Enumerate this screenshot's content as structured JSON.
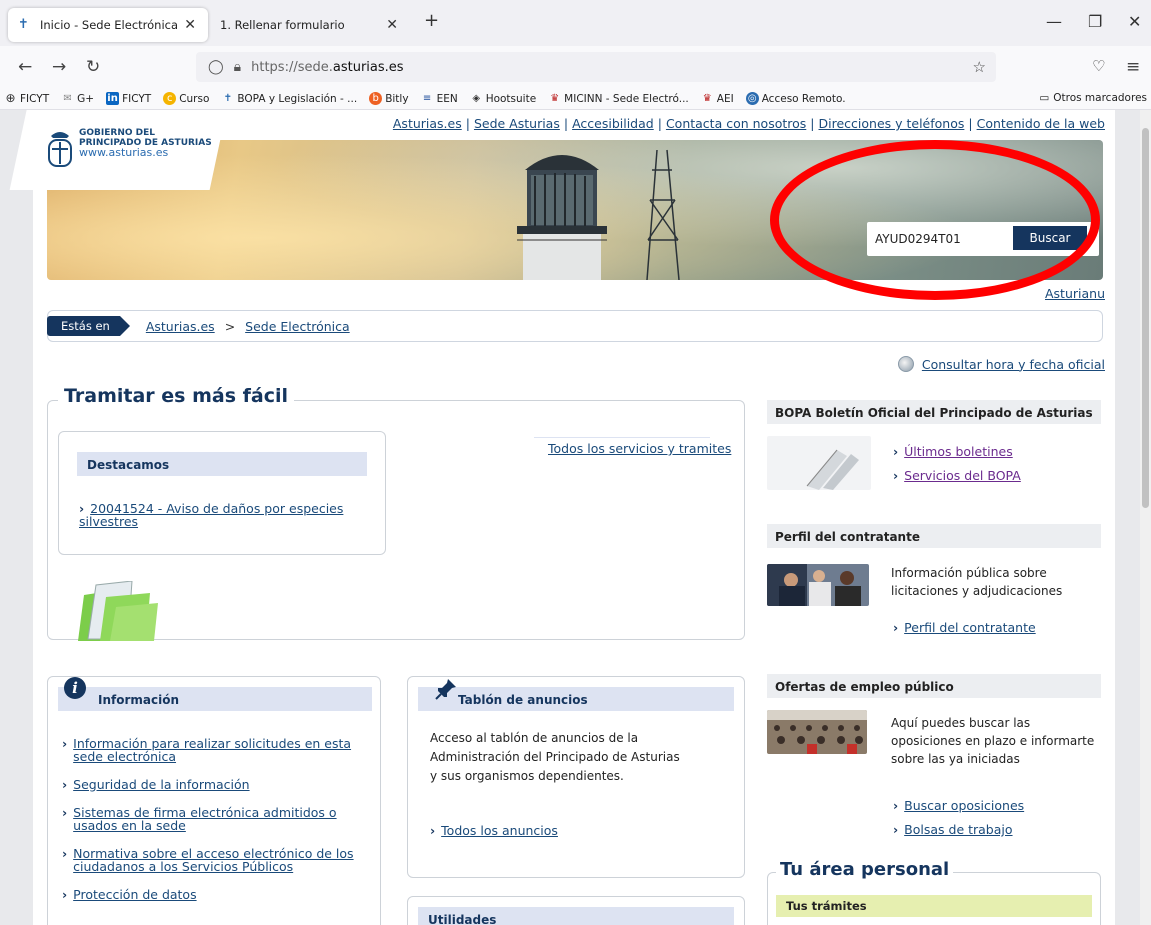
{
  "browser": {
    "tabs": [
      {
        "label": "Inicio - Sede Electrónica",
        "active": true
      },
      {
        "label": "1. Rellenar formulario",
        "active": false
      }
    ],
    "url_prefix": "https://sede.",
    "url_host": "asturias.es",
    "bookmarks": [
      {
        "label": "FICYT",
        "icon": "globe-icon"
      },
      {
        "label": "G+",
        "icon": "google-plus-icon"
      },
      {
        "label": "FICYT",
        "icon": "linkedin-icon"
      },
      {
        "label": "Curso",
        "icon": "coursera-icon"
      },
      {
        "label": "BOPA y Legislación - ...",
        "icon": "asturias-icon"
      },
      {
        "label": "Bitly",
        "icon": "bitly-icon"
      },
      {
        "label": "EEN",
        "icon": "een-icon"
      },
      {
        "label": "Hootsuite",
        "icon": "hootsuite-icon"
      },
      {
        "label": "MICINN - Sede Electró...",
        "icon": "spain-shield-icon"
      },
      {
        "label": "AEI",
        "icon": "spain-shield-icon"
      },
      {
        "label": "Acceso Remoto.",
        "icon": "remote-icon"
      }
    ],
    "other_bookmarks": "Otros marcadores"
  },
  "header": {
    "top_links": [
      "Asturias.es",
      "Sede Asturias",
      "Accesibilidad",
      "Contacta con nosotros",
      "Direcciones y teléfonos",
      "Contenido de la web"
    ],
    "logo_line1": "GOBIERNO DEL",
    "logo_line2": "PRINCIPADO DE ASTURIAS",
    "logo_url": "www.asturias.es",
    "search_value": "AYUD0294T01",
    "search_button": "Buscar",
    "language_link": "Asturianu"
  },
  "breadcrumb": {
    "label": "Estás en",
    "items": [
      "Asturias.es",
      "Sede Electrónica"
    ],
    "separator": ">"
  },
  "official_time_link": "Consultar hora y fecha oficial",
  "tramitar": {
    "title": "Tramitar es más fácil",
    "featured_header": "Destacamos",
    "featured_link": "20041524 - Aviso de daños por especies silvestres",
    "all_services_link": "Todos los servicios y tramites"
  },
  "informacion": {
    "header": "Información",
    "links": [
      "Información para realizar solicitudes en esta sede electrónica",
      "Seguridad de la información",
      "Sistemas de firma electrónica admitidos o usados en la sede",
      "Normativa sobre el acceso electrónico de los ciudadanos a los Servicios Públicos",
      "Protección de datos"
    ]
  },
  "tablon": {
    "header": "Tablón de anuncios",
    "text": "Acceso al tablón de anuncios de la Administración del Principado de Asturias y sus organismos dependientes.",
    "link": "Todos los anuncios"
  },
  "utilidades": {
    "header": "Utilidades"
  },
  "bopa": {
    "header": "BOPA Boletín Oficial del Principado de Asturias",
    "links": [
      "Últimos boletines",
      "Servicios del BOPA"
    ]
  },
  "perfil": {
    "header": "Perfil del contratante",
    "text": "Información pública sobre licitaciones y adjudicaciones",
    "link": "Perfil del contratante"
  },
  "empleo": {
    "header": "Ofertas de empleo público",
    "text": "Aquí puedes buscar las oposiciones en plazo e informarte sobre las ya iniciadas",
    "links": [
      "Buscar oposiciones",
      "Bolsas de trabajo"
    ]
  },
  "area_personal": {
    "title": "Tu área personal",
    "subheader": "Tus trámites"
  },
  "colors": {
    "navy": "#15355e",
    "link": "#1a4a7a",
    "box_head": "#dde3f2",
    "highlight_ellipse": "#ff0000"
  }
}
